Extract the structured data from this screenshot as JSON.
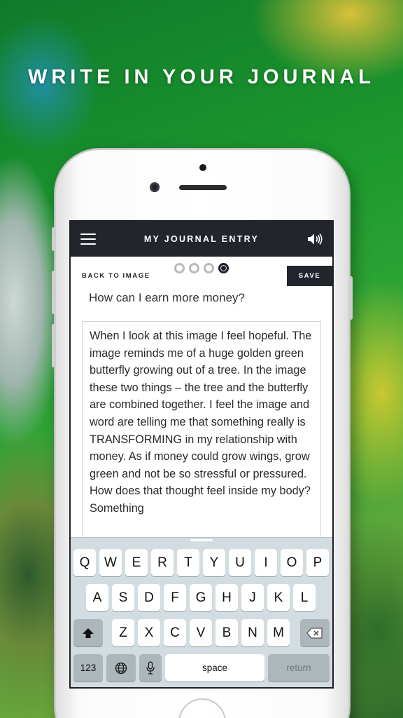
{
  "headline": "WRITE IN YOUR JOURNAL",
  "app": {
    "title": "MY JOURNAL ENTRY",
    "back_label": "BACK TO IMAGE",
    "save_label": "SAVE",
    "progress": {
      "total_steps": 4,
      "current_step": 4
    },
    "question": "How can I earn more money?",
    "entry_text": "When I look at this image I feel hopeful. The image reminds me of a huge golden green butterfly growing out of a tree. In the image these two things – the tree and the butterfly are combined together. I feel the image and word are telling me that something really is TRANSFORMING in my relationship with money. As if money could grow wings, grow green and not be so stressful or pressured. How does that thought feel inside my body? Something"
  },
  "keyboard": {
    "row1": [
      "Q",
      "W",
      "E",
      "R",
      "T",
      "Y",
      "U",
      "I",
      "O",
      "P"
    ],
    "row2": [
      "A",
      "S",
      "D",
      "F",
      "G",
      "H",
      "J",
      "K",
      "L"
    ],
    "row3": [
      "Z",
      "X",
      "C",
      "V",
      "B",
      "N",
      "M"
    ],
    "numbers_label": "123",
    "space_label": "space",
    "return_label": "return"
  },
  "icons": [
    "menu-icon",
    "speaker-icon",
    "shift-icon",
    "backspace-icon",
    "globe-icon",
    "microphone-icon"
  ]
}
